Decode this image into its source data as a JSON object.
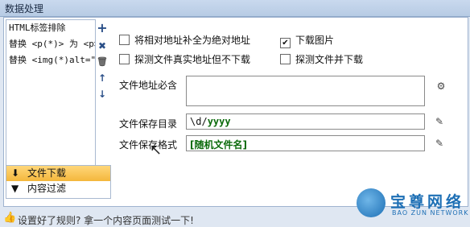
{
  "window": {
    "title": "数据处理"
  },
  "rules": {
    "items": [
      "HTML标签排除",
      "替换 <p(*)> 为 <p>",
      "替换 <img(*)alt=\""
    ]
  },
  "tools": {
    "add": "+",
    "delete": "✖",
    "trash": "🗑",
    "up": "↑",
    "down": "↓"
  },
  "tabs": [
    {
      "label": "文件下载",
      "icon": "download-icon",
      "active": true
    },
    {
      "label": "内容过滤",
      "icon": "filter-icon",
      "active": false
    }
  ],
  "options": {
    "abs_url": {
      "label": "将相对地址补全为绝对地址",
      "checked": false
    },
    "download_images": {
      "label": "下载图片",
      "checked": true
    },
    "probe_real": {
      "label": "探测文件真实地址但不下载",
      "checked": false
    },
    "probe_download": {
      "label": "探测文件并下载",
      "checked": false
    }
  },
  "fields": {
    "must_contain": {
      "label": "文件地址必含",
      "value": ""
    },
    "save_dir": {
      "label": "文件保存目录",
      "value_prefix": "\\d/",
      "value_token": "yyyy"
    },
    "save_format": {
      "label": "文件保存格式",
      "value": "[随机文件名]"
    }
  },
  "footer": {
    "text": "设置好了规则? 拿一个内容页面测试一下!"
  },
  "logo": {
    "cn": "宝尊网络",
    "en": "BAO ZUN NETWORK"
  }
}
